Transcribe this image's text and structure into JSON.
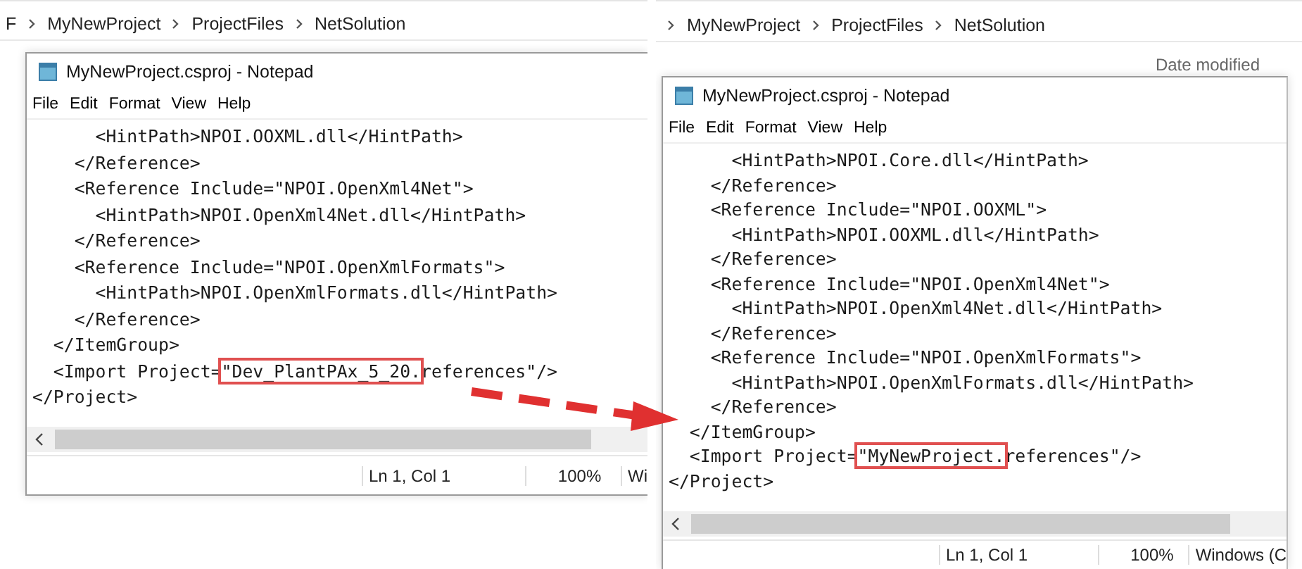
{
  "panels": [
    {
      "breadcrumb": {
        "leading_separator": false,
        "items": [
          "F",
          "MyNewProject",
          "ProjectFiles",
          "NetSolution"
        ]
      },
      "notepad": {
        "title": "MyNewProject.csproj - Notepad",
        "menu": [
          "File",
          "Edit",
          "Format",
          "View",
          "Help"
        ],
        "lines": [
          {
            "parts": [
              {
                "text": "      <HintPath>NPOI.OOXML.dll</HintPath>",
                "boxed": false
              }
            ]
          },
          {
            "parts": [
              {
                "text": "    </Reference>",
                "boxed": false
              }
            ]
          },
          {
            "parts": [
              {
                "text": "    <Reference Include=\"NPOI.OpenXml4Net\">",
                "boxed": false
              }
            ]
          },
          {
            "parts": [
              {
                "text": "      <HintPath>NPOI.OpenXml4Net.dll</HintPath>",
                "boxed": false
              }
            ]
          },
          {
            "parts": [
              {
                "text": "    </Reference>",
                "boxed": false
              }
            ]
          },
          {
            "parts": [
              {
                "text": "    <Reference Include=\"NPOI.OpenXmlFormats\">",
                "boxed": false
              }
            ]
          },
          {
            "parts": [
              {
                "text": "      <HintPath>NPOI.OpenXmlFormats.dll</HintPath>",
                "boxed": false
              }
            ]
          },
          {
            "parts": [
              {
                "text": "    </Reference>",
                "boxed": false
              }
            ]
          },
          {
            "parts": [
              {
                "text": "  </ItemGroup>",
                "boxed": false
              }
            ]
          },
          {
            "parts": [
              {
                "text": "  <Import Project=",
                "boxed": false
              },
              {
                "text": "\"Dev_PlantPAx_5_20.",
                "boxed": true
              },
              {
                "text": "references\"/>",
                "boxed": false
              }
            ]
          },
          {
            "parts": [
              {
                "text": "</Project>",
                "boxed": false
              }
            ]
          }
        ],
        "status": [
          "Ln 1, Col 1",
          "100%",
          "Wi"
        ]
      }
    },
    {
      "breadcrumb": {
        "leading_separator": true,
        "items": [
          "MyNewProject",
          "ProjectFiles",
          "NetSolution"
        ]
      },
      "column_header": "Date modified",
      "notepad": {
        "title": "MyNewProject.csproj - Notepad",
        "menu": [
          "File",
          "Edit",
          "Format",
          "View",
          "Help"
        ],
        "lines": [
          {
            "parts": [
              {
                "text": "      <HintPath>NPOI.Core.dll</HintPath>",
                "boxed": false
              }
            ]
          },
          {
            "parts": [
              {
                "text": "    </Reference>",
                "boxed": false
              }
            ]
          },
          {
            "parts": [
              {
                "text": "    <Reference Include=\"NPOI.OOXML\">",
                "boxed": false
              }
            ]
          },
          {
            "parts": [
              {
                "text": "      <HintPath>NPOI.OOXML.dll</HintPath>",
                "boxed": false
              }
            ]
          },
          {
            "parts": [
              {
                "text": "    </Reference>",
                "boxed": false
              }
            ]
          },
          {
            "parts": [
              {
                "text": "    <Reference Include=\"NPOI.OpenXml4Net\">",
                "boxed": false
              }
            ]
          },
          {
            "parts": [
              {
                "text": "      <HintPath>NPOI.OpenXml4Net.dll</HintPath>",
                "boxed": false
              }
            ]
          },
          {
            "parts": [
              {
                "text": "    </Reference>",
                "boxed": false
              }
            ]
          },
          {
            "parts": [
              {
                "text": "    <Reference Include=\"NPOI.OpenXmlFormats\">",
                "boxed": false
              }
            ]
          },
          {
            "parts": [
              {
                "text": "      <HintPath>NPOI.OpenXmlFormats.dll</HintPath>",
                "boxed": false
              }
            ]
          },
          {
            "parts": [
              {
                "text": "    </Reference>",
                "boxed": false
              }
            ]
          },
          {
            "parts": [
              {
                "text": "  </ItemGroup>",
                "boxed": false
              }
            ]
          },
          {
            "parts": [
              {
                "text": "  <Import Project=",
                "boxed": false
              },
              {
                "text": "\"MyNewProject.",
                "boxed": true
              },
              {
                "text": "references\"/>",
                "boxed": false
              }
            ]
          },
          {
            "parts": [
              {
                "text": "</Project>",
                "boxed": false
              }
            ]
          }
        ],
        "status": [
          "Ln 1, Col 1",
          "100%",
          "Windows (C"
        ]
      }
    }
  ]
}
